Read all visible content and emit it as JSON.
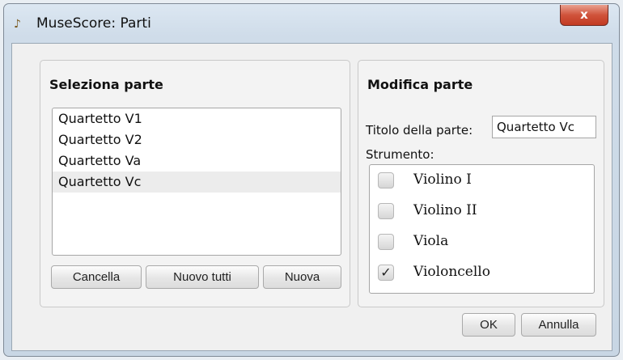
{
  "window": {
    "app_icon": "musescore-icon",
    "title": "MuseScore: Parti",
    "close_label": "x"
  },
  "select_part": {
    "heading": "Seleziona parte",
    "parts": [
      "Quartetto V1",
      "Quartetto V2",
      "Quartetto Va",
      "Quartetto Vc"
    ],
    "selected_index": 3,
    "buttons": {
      "delete": "Cancella",
      "new_all": "Nuovo tutti",
      "new": "Nuova"
    }
  },
  "edit_part": {
    "heading": "Modifica parte",
    "title_label": "Titolo della parte:",
    "title_value": "Quartetto Vc",
    "instrument_label": "Strumento:",
    "instruments": [
      {
        "name": "Violino I",
        "checked": false
      },
      {
        "name": "Violino II",
        "checked": false
      },
      {
        "name": "Viola",
        "checked": false
      },
      {
        "name": "Violoncello",
        "checked": true
      }
    ]
  },
  "footer": {
    "ok": "OK",
    "cancel": "Annulla"
  }
}
